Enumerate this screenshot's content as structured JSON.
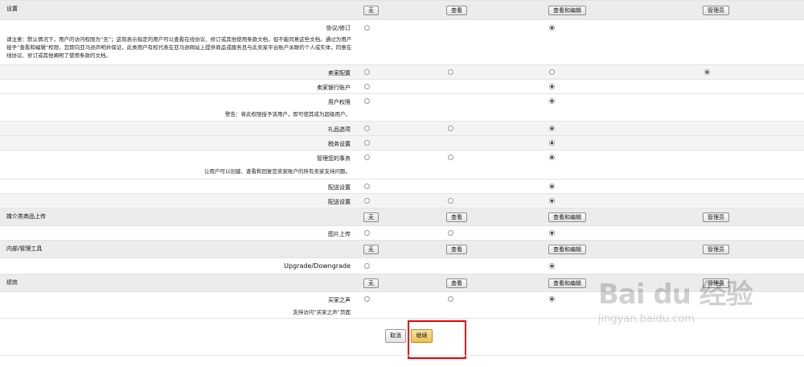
{
  "columns": [
    "无",
    "查看",
    "查看和编辑",
    "管理员"
  ],
  "sections": {
    "settings": "设置",
    "media": "媒介类商品上传",
    "internal": "内部/管理工具",
    "performance": "绩效"
  },
  "rows": {
    "agreement": "协议/修订",
    "seller_config": "卖家配置",
    "seller_bank": "卖家银行账户",
    "user_perm": "用户权限",
    "gift": "礼品选项",
    "tax": "税务设置",
    "manage_cases": "管理您的事务",
    "shipping1": "配送设置",
    "shipping2": "配送设置",
    "image_upload": "图片上传",
    "upgrade": "Upgrade/Downgrade",
    "buyer_voice": "买家之声"
  },
  "notes": {
    "agreement": "请注意：默认情况下，用户的访问权限为“无”；这就表示指定的用户可以查看在线协议、修订或其他使用条款文档，但不能同意这些文档。通过为用户授予“查看和编辑”权限，您即向亚马逊声明并保证，此类用户有权代表在亚马逊网站上提供商品或服务且与此卖家平台账户关联的个人或实体，同意在线协议、修订或其他阐明了使用条款的文档。",
    "user_perm": "警告：将此权限授予该用户，即可使其成为超级用户。",
    "manage_cases": "让用户可以创建、查看和回复您卖家账户的所有卖家支持问题。",
    "buyer_voice": "支持访问“买家之声”页面"
  },
  "footer": {
    "cancel": "取消",
    "continue": "继续"
  },
  "watermark": {
    "logo": "Bai du 经验",
    "url": "jingyan.baidu.com"
  }
}
